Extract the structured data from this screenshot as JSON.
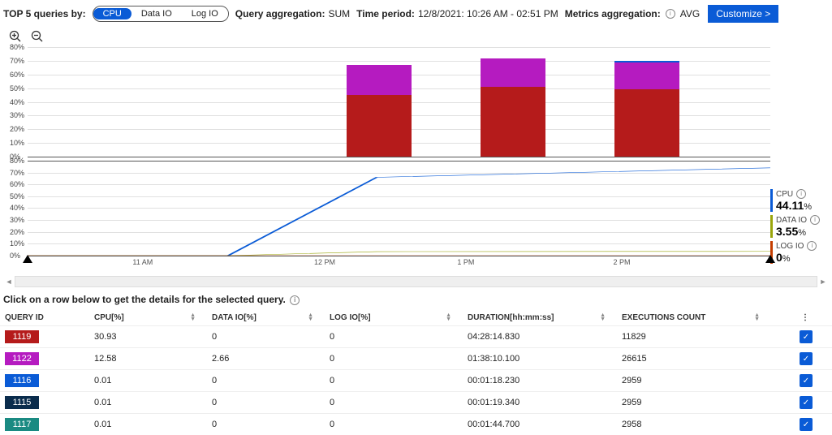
{
  "toolbar": {
    "top5_label": "TOP 5 queries by:",
    "seg": {
      "cpu": "CPU",
      "dataio": "Data IO",
      "logio": "Log IO"
    },
    "qagg_label": "Query aggregation:",
    "qagg_value": "SUM",
    "tperiod_label": "Time period:",
    "tperiod_value": "12/8/2021: 10:26 AM - 02:51 PM",
    "magg_label": "Metrics aggregation:",
    "magg_value": "AVG",
    "customize": "Customize >"
  },
  "legend": {
    "cpu": {
      "label": "CPU",
      "value": "44.11",
      "unit": "%",
      "color": "#0a5bd6"
    },
    "dataio": {
      "label": "DATA IO",
      "value": "3.55",
      "unit": "%",
      "color": "#9aa50b"
    },
    "logio": {
      "label": "LOG IO",
      "value": "0",
      "unit": "%",
      "color": "#c43d00"
    }
  },
  "chart_data": [
    {
      "type": "bar-stacked",
      "ylabel": "%",
      "ylim": [
        0,
        80
      ],
      "yticks": [
        "0%",
        "10%",
        "20%",
        "30%",
        "40%",
        "50%",
        "60%",
        "70%",
        "80%"
      ],
      "categories": [
        "12 PM",
        "1 PM",
        "2 PM"
      ],
      "series": [
        {
          "name": "1119",
          "color": "#b51b1b",
          "values": [
            45,
            51,
            49
          ]
        },
        {
          "name": "1122",
          "color": "#b51bc0",
          "values": [
            22,
            21,
            22
          ]
        }
      ]
    },
    {
      "type": "line",
      "ylabel": "%",
      "ylim": [
        0,
        80
      ],
      "yticks": [
        "0%",
        "10%",
        "20%",
        "30%",
        "40%",
        "50%",
        "60%",
        "70%",
        "80%"
      ],
      "x": [
        "11 AM",
        "12 PM",
        "1 PM",
        "2 PM"
      ],
      "series": [
        {
          "name": "CPU",
          "color": "#0a5bd6",
          "values": [
            0,
            0,
            66,
            74,
            74
          ]
        },
        {
          "name": "DATA IO",
          "color": "#9aa50b",
          "values": [
            0,
            0,
            3.4,
            3.6,
            3.6
          ]
        },
        {
          "name": "LOG IO",
          "color": "#c43d00",
          "values": [
            0,
            0,
            0,
            0,
            0
          ]
        }
      ]
    }
  ],
  "xticks": {
    "t1": "11 AM",
    "t2": "12 PM",
    "t3": "1 PM",
    "t4": "2 PM"
  },
  "table": {
    "instruction": "Click on a row below to get the details for the selected query.",
    "headers": {
      "qid": "QUERY ID",
      "cpu": "CPU[%]",
      "dio": "DATA IO[%]",
      "lio": "LOG IO[%]",
      "dur": "DURATION[hh:mm:ss]",
      "exc": "EXECUTIONS COUNT"
    },
    "rows": [
      {
        "qid": "1119",
        "color": "#b51b1b",
        "cpu": "30.93",
        "dio": "0",
        "lio": "0",
        "dur": "04:28:14.830",
        "exc": "11829"
      },
      {
        "qid": "1122",
        "color": "#b51bc0",
        "cpu": "12.58",
        "dio": "2.66",
        "lio": "0",
        "dur": "01:38:10.100",
        "exc": "26615"
      },
      {
        "qid": "1116",
        "color": "#0a5bd6",
        "cpu": "0.01",
        "dio": "0",
        "lio": "0",
        "dur": "00:01:18.230",
        "exc": "2959"
      },
      {
        "qid": "1115",
        "color": "#0a2c4c",
        "cpu": "0.01",
        "dio": "0",
        "lio": "0",
        "dur": "00:01:19.340",
        "exc": "2959"
      },
      {
        "qid": "1117",
        "color": "#1a8a82",
        "cpu": "0.01",
        "dio": "0",
        "lio": "0",
        "dur": "00:01:44.700",
        "exc": "2958"
      }
    ]
  }
}
